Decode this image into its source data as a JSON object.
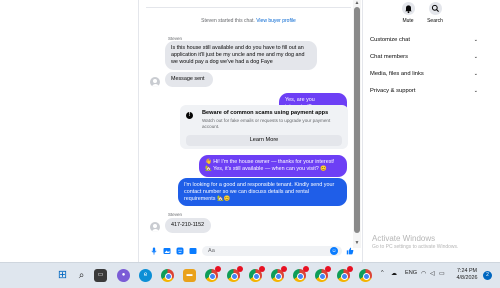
{
  "system_message": {
    "text": "Steven started this chat.",
    "link": "View buyer profile"
  },
  "messages": {
    "first_sender": "Steven",
    "inquiry": "Is this house still available and do you have to fill out an application it'll just be my uncle and me and my dog and we would pay a dog we've had a dog Faye",
    "message_sent": "Message sent",
    "seller_question": "Yes, are you interested?",
    "seller_intro_1": "👋 Hi! I'm the house owner — thanks for your interest!",
    "seller_intro_2": "🏡 Yes, it's still available — when can you visit? 😊",
    "seller_request": "I'm looking for a good and responsible tenant. Kindly send your contact number so we can discuss details and rental requirements 🏡😊",
    "second_sender": "Steven",
    "phone": "417-210-1152"
  },
  "warning_card": {
    "title": "Beware of common scams using payment apps",
    "body": "Watch out for fake emails or requests to upgrade your payment account.",
    "button": "Learn More",
    "icon": "shield-alert-icon"
  },
  "composer": {
    "placeholder": "Aa",
    "icons": [
      "microphone-icon",
      "image-icon",
      "sticker-icon",
      "gif-icon",
      "emoji-icon",
      "like-icon"
    ]
  },
  "right_panel": {
    "mute_label": "Mute",
    "search_label": "Search",
    "sections": [
      "Customize chat",
      "Chat members",
      "Media, files and links",
      "Privacy & support"
    ]
  },
  "watermark": {
    "title": "Activate Windows",
    "subtitle": "Go to PC settings to activate Windows."
  },
  "taskbar": {
    "language": "ENG",
    "time": "7:24 PM",
    "date": "4/8/2026",
    "notification_count": "2"
  },
  "colors": {
    "accent_purple": "#6d3ff5",
    "accent_blue": "#1f5ee8",
    "messenger_blue": "#0a7cff",
    "incoming_bubble": "#e4e6eb"
  }
}
